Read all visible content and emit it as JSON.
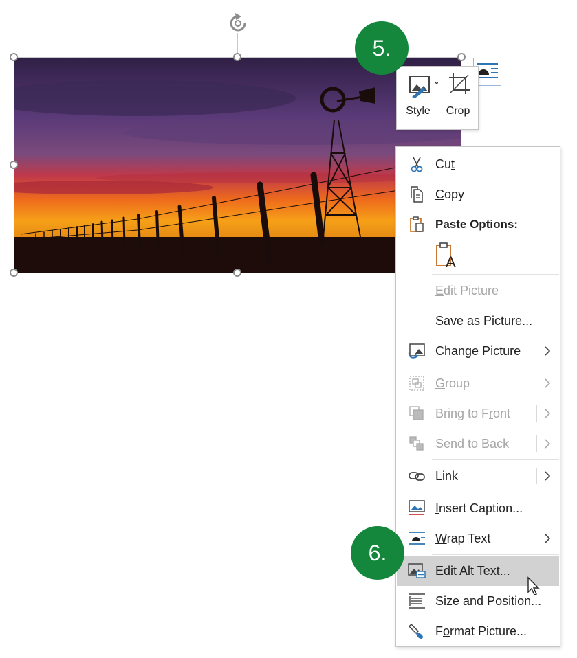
{
  "toolbar": {
    "style_label": "Style",
    "crop_label": "Crop",
    "style_icon": "picture-style-icon",
    "crop_icon": "crop-icon"
  },
  "steps": {
    "step5": "5.",
    "step6": "6."
  },
  "colors": {
    "step_badge": "#14873c",
    "menu_highlight": "#d2d2d2",
    "disabled_text": "#a6a6a6"
  },
  "context_menu": {
    "cut": {
      "pre": "Cu",
      "key": "t",
      "post": "",
      "icon": "scissors-icon"
    },
    "copy": {
      "pre": "",
      "key": "C",
      "post": "opy",
      "icon": "copy-icon"
    },
    "paste_options": {
      "label": "Paste Options:",
      "icon": "clipboard-icon"
    },
    "paste_text_only": {
      "icon": "paste-keep-text-only-icon"
    },
    "edit_picture": {
      "pre": "",
      "key": "E",
      "post": "dit Picture",
      "enabled": false
    },
    "save_as_picture": {
      "pre": "",
      "key": "S",
      "post": "ave as Picture...",
      "enabled": true
    },
    "change_picture": {
      "pre": "Chan",
      "key": "g",
      "post": "e Picture",
      "icon": "change-picture-icon",
      "has_submenu": true
    },
    "group": {
      "pre": "",
      "key": "G",
      "post": "roup",
      "icon": "group-icon",
      "enabled": false,
      "has_submenu": true
    },
    "bring_to_front": {
      "pre": "Bring to F",
      "key": "r",
      "post": "ont",
      "icon": "bring-to-front-icon",
      "enabled": false,
      "has_submenu": true
    },
    "send_to_back": {
      "pre": "Send to Bac",
      "key": "k",
      "post": "",
      "icon": "send-to-back-icon",
      "enabled": false,
      "has_submenu": true
    },
    "link": {
      "pre": "L",
      "key": "i",
      "post": "nk",
      "icon": "link-icon",
      "has_submenu": true
    },
    "insert_caption": {
      "pre": "",
      "key": "I",
      "post": "nsert Caption...",
      "icon": "insert-caption-icon"
    },
    "wrap_text": {
      "pre": "",
      "key": "W",
      "post": "rap Text",
      "icon": "wrap-text-icon",
      "has_submenu": true
    },
    "edit_alt_text": {
      "pre": "Edit ",
      "key": "A",
      "post": "lt Text...",
      "icon": "alt-text-icon",
      "highlighted": true
    },
    "size_position": {
      "pre": "Si",
      "key": "z",
      "post": "e and Position...",
      "icon": "size-position-icon"
    },
    "format_picture": {
      "pre": "F",
      "key": "o",
      "post": "rmat Picture...",
      "icon": "format-picture-icon"
    }
  }
}
